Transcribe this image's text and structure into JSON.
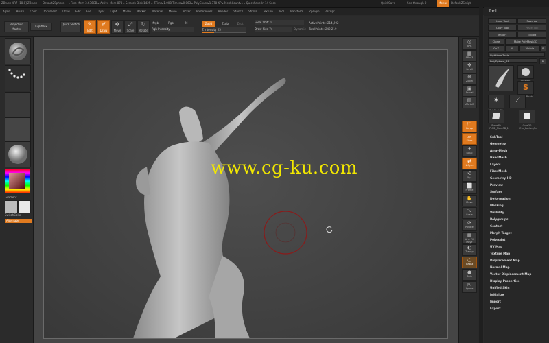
{
  "titlebar": {
    "app": "ZBrush 4R7 [18.0] ZBrush",
    "doc": "DefaultZSphere",
    "stats": "▸ Free Mem 3.636GB ▸ Active Mem 878 ▸ Scratch Disk 1425 ▸ ZTime▸1.008 Timers▸0.063 ▸ PolyCount▸1.378 KP ▸ MeshCount▸1 ▸ QuickSave In 14 Secs",
    "quicksave": "QuickSave",
    "seethrough": "See-through 0",
    "menus_chip": "Menus",
    "script": "DefaultZScript"
  },
  "menubar": {
    "items": [
      "Alpha",
      "Brush",
      "Color",
      "Document",
      "Draw",
      "Edit",
      "File",
      "Layer",
      "Light",
      "Macro",
      "Marker",
      "Material",
      "Movie",
      "Picker",
      "Preferences",
      "Render",
      "Stencil",
      "Stroke",
      "Texture",
      "Tool",
      "Transform",
      "Zplugin",
      "Zscript"
    ]
  },
  "toolbar": {
    "projection_master": "Projection Master",
    "lightbox": "LightBox",
    "quick_sketch": "Quick Sketch",
    "edit": "Edit",
    "draw": "Draw",
    "move": "Move",
    "scale": "Scale",
    "rotate": "Rotate",
    "mrgb": "Mrgb",
    "rgb": "Rgb",
    "m": "M",
    "rgb_intensity": "Rgb Intensity",
    "zadd": "Zadd",
    "zsub": "Zsub",
    "zcut": "Zcut",
    "z_intensity": "Z Intensity 25",
    "focal_shift": "Focal Shift 0",
    "draw_size": "Draw Size 74",
    "dynamic": "Dynamic",
    "active_points": "ActivePoints: 214,292",
    "total_points": "TotalPoints: 242,219"
  },
  "leftshelf": {
    "gradient": "Gradient",
    "switch_color": "SwitchColor",
    "alternate": "Alternate"
  },
  "canvas": {
    "watermark": "www.cg-ku.com"
  },
  "rightdock": {
    "items": [
      "BPR",
      "SPix 3",
      "Scroll",
      "Zoom",
      "Actual",
      "AAHalf",
      "Persp",
      "Floor",
      "Local",
      "L.Sym",
      "Xyz",
      "Frame",
      "Move",
      "Scale",
      "Rotate",
      "Line Fill PolyF",
      "Transp",
      "Ghost",
      "Solo",
      "Xpose"
    ]
  },
  "toolpanel": {
    "title": "Tool",
    "load_tool": "Load Tool",
    "save_as": "Save As",
    "copy_tool": "Copy Tool",
    "paste_tool": "Paste Tool",
    "import": "Import",
    "export": "Export",
    "clone": "Clone",
    "make_polymesh": "Make PolyMesh3D",
    "goz": "GoZ",
    "all": "All",
    "visible": "Visible",
    "r": "R",
    "lightbox_tools": "Lightbox▸Tools",
    "current_tool": "PolySphere_48",
    "r2": "R",
    "thumbs": [
      "PolySphere",
      "SphereBr",
      "SimpleBrush",
      "PolyMesh3D",
      "Plane3D",
      "Cube3D",
      "PM3D_Plane3D_1",
      "Eve_Coeller_Ani"
    ],
    "subpalettes": [
      "SubTool",
      "Geometry",
      "ArrayMesh",
      "NanoMesh",
      "Layers",
      "FiberMesh",
      "Geometry HD",
      "Preview",
      "Surface",
      "Deformation",
      "Masking",
      "Visibility",
      "Polygroups",
      "Contact",
      "Morph Target",
      "Polypaint",
      "UV Map",
      "Texture Map",
      "Displacement Map",
      "Normal Map",
      "Vector Displacement Map",
      "Display Properties",
      "Unified Skin",
      "Initialize",
      "Import",
      "Export"
    ]
  }
}
